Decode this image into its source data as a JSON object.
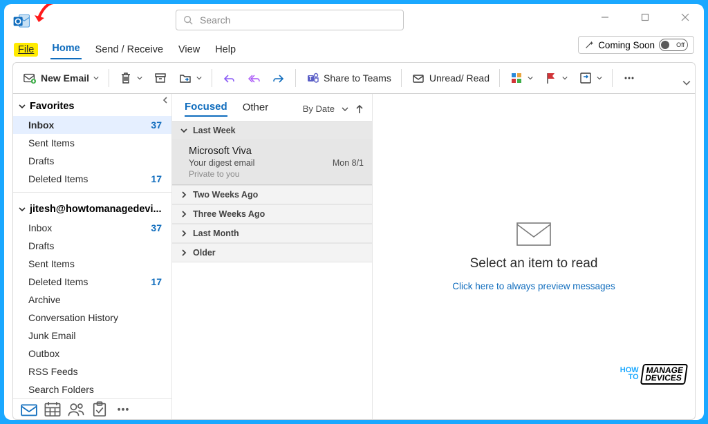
{
  "titlebar": {
    "search_placeholder": "Search"
  },
  "tabs": {
    "file": "File",
    "home": "Home",
    "sendreceive": "Send / Receive",
    "view": "View",
    "help": "Help",
    "coming_soon": "Coming Soon",
    "toggle_off": "Off"
  },
  "ribbon": {
    "new_email": "New Email",
    "share_teams": "Share to Teams",
    "unread_read": "Unread/ Read"
  },
  "nav": {
    "favorites": "Favorites",
    "account": "jitesh@howtomanagedevi...",
    "items_fav": [
      {
        "label": "Inbox",
        "count": "37",
        "bold": true,
        "sel": true
      },
      {
        "label": "Sent Items"
      },
      {
        "label": "Drafts"
      },
      {
        "label": "Deleted Items",
        "count": "17"
      }
    ],
    "items_acct": [
      {
        "label": "Inbox",
        "count": "37"
      },
      {
        "label": "Drafts"
      },
      {
        "label": "Sent Items"
      },
      {
        "label": "Deleted Items",
        "count": "17"
      },
      {
        "label": "Archive"
      },
      {
        "label": "Conversation History"
      },
      {
        "label": "Junk Email"
      },
      {
        "label": "Outbox"
      },
      {
        "label": "RSS Feeds"
      },
      {
        "label": "Search Folders"
      }
    ]
  },
  "list": {
    "tab_focused": "Focused",
    "tab_other": "Other",
    "sort": "By Date",
    "groups": {
      "last_week": "Last Week",
      "two_weeks": "Two Weeks Ago",
      "three_weeks": "Three Weeks Ago",
      "last_month": "Last Month",
      "older": "Older"
    },
    "mail": {
      "from": "Microsoft Viva",
      "subject": "Your digest email",
      "date": "Mon 8/1",
      "tag": "Private to you"
    }
  },
  "reader": {
    "title": "Select an item to read",
    "link": "Click here to always preview messages"
  },
  "watermark": {
    "how": "HOW",
    "to": "TO",
    "manage": "MANAGE",
    "devices": "DEVICES"
  }
}
